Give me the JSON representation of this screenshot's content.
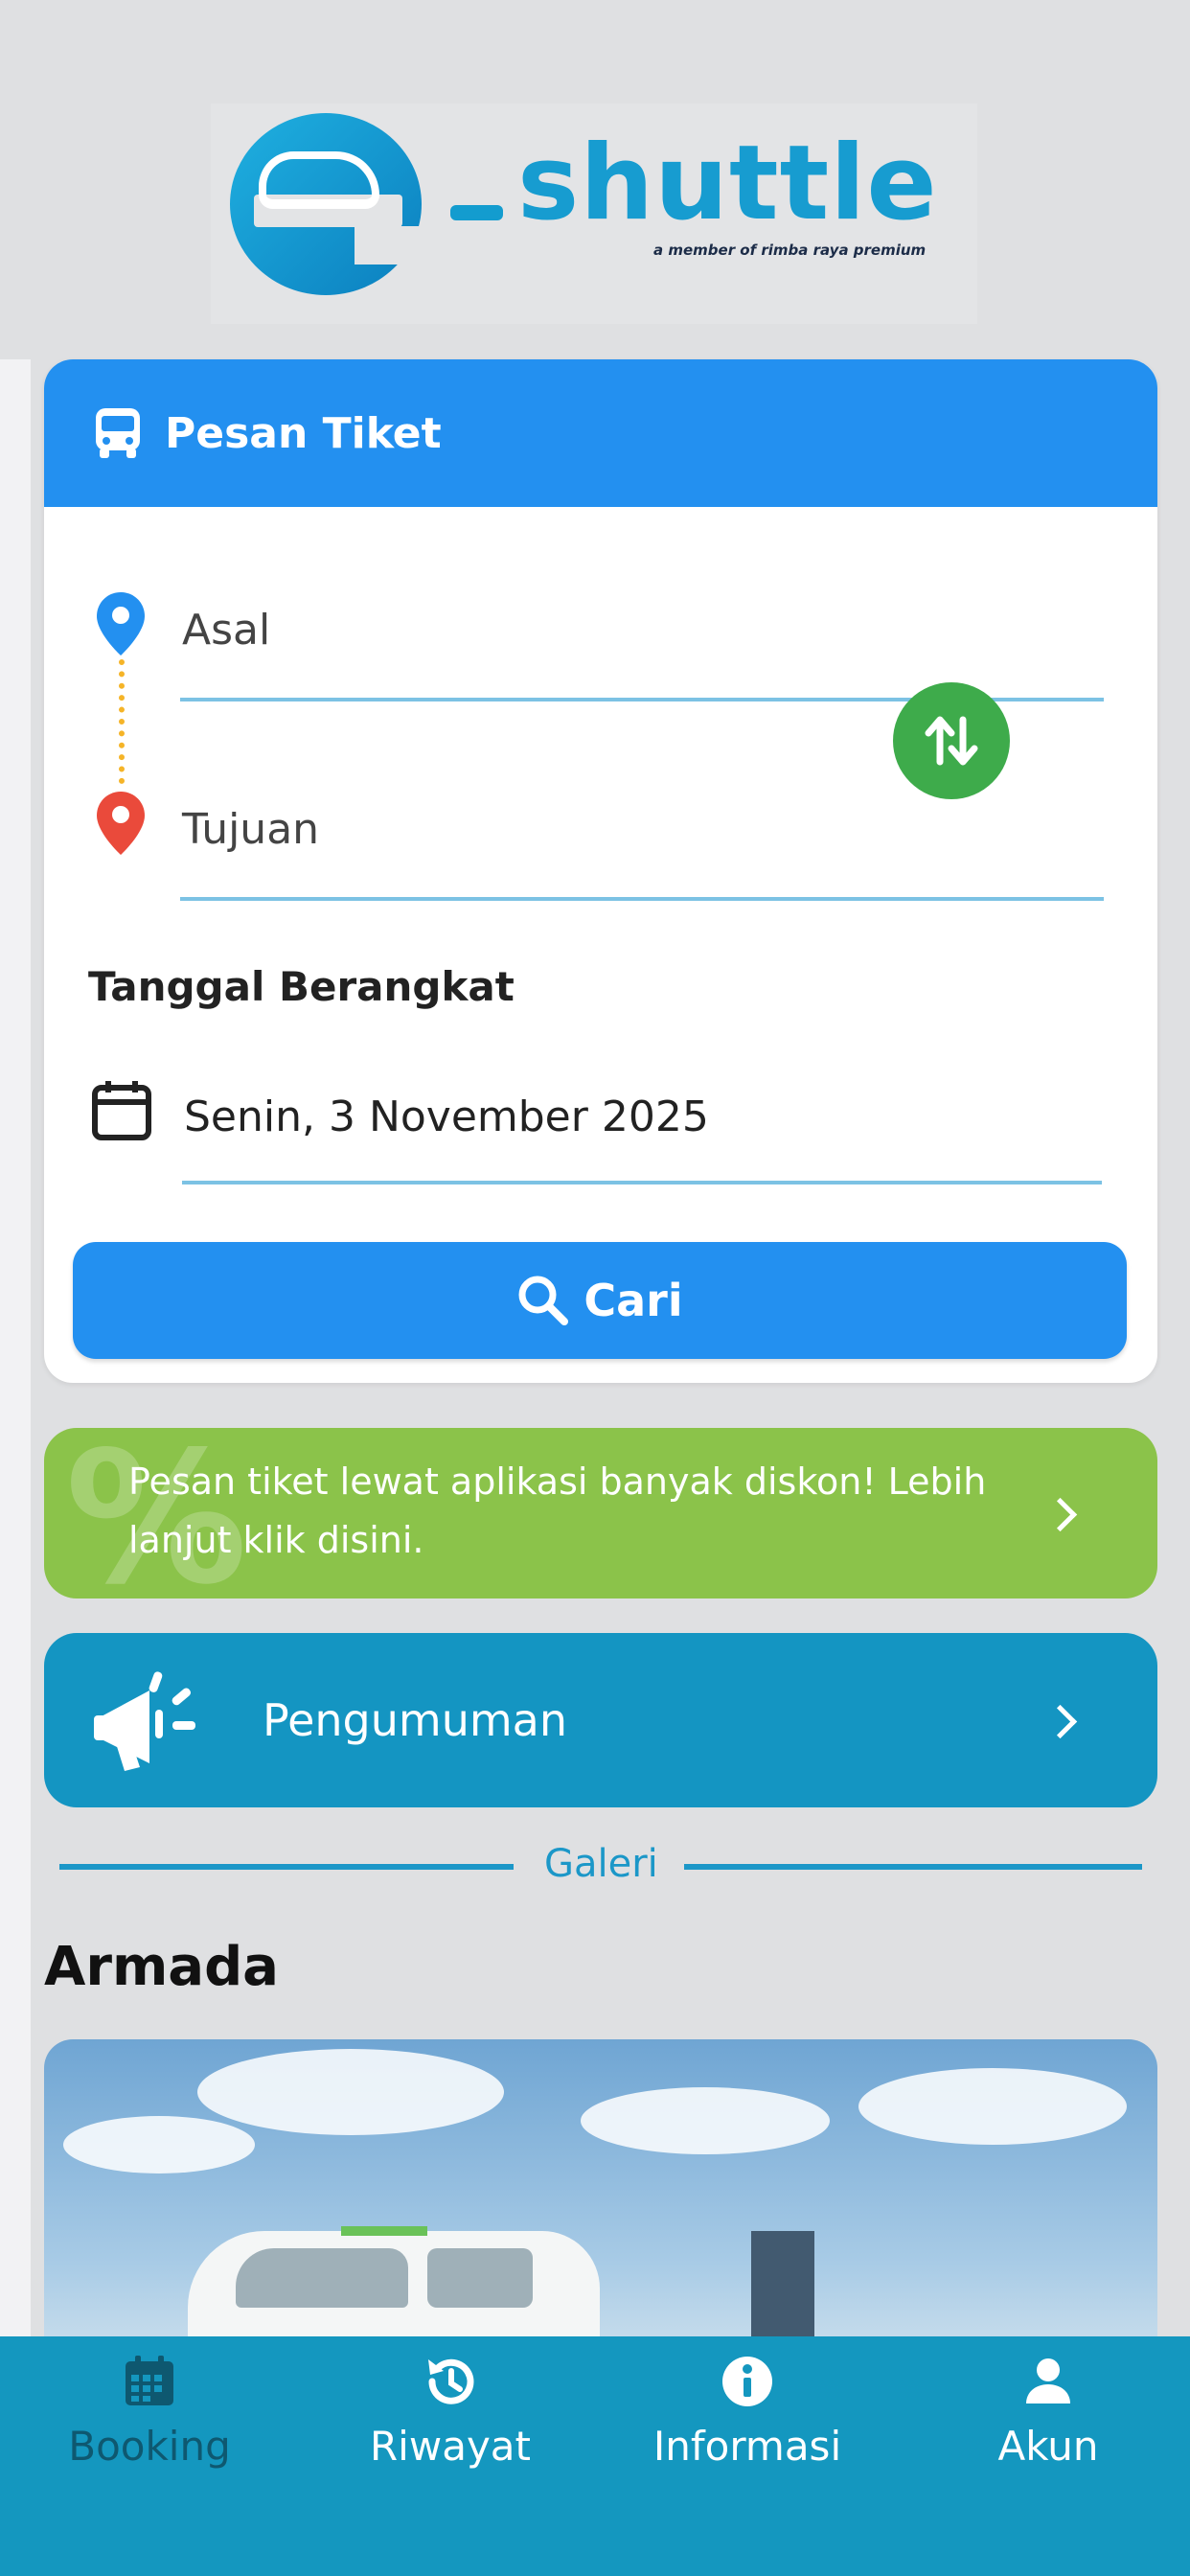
{
  "brand": {
    "name": "shuttle",
    "tagline": "a member of rimba raya premium"
  },
  "booking": {
    "header_title": "Pesan Tiket",
    "origin_placeholder": "Asal",
    "destination_placeholder": "Tujuan",
    "date_label": "Tanggal Berangkat",
    "date_value": "Senin, 3 November 2025",
    "search_label": "Cari"
  },
  "promo": {
    "text": "Pesan tiket lewat aplikasi banyak diskon! Lebih lanjut klik disini."
  },
  "announcement": {
    "label": "Pengumuman"
  },
  "gallery": {
    "divider_label": "Galeri",
    "section_title": "Armada"
  },
  "nav": {
    "items": [
      {
        "label": "Booking",
        "icon": "calendar-icon",
        "active": true
      },
      {
        "label": "Riwayat",
        "icon": "history-icon",
        "active": false
      },
      {
        "label": "Informasi",
        "icon": "info-icon",
        "active": false
      },
      {
        "label": "Akun",
        "icon": "person-icon",
        "active": false
      }
    ]
  },
  "colors": {
    "primary": "#2390f0",
    "swap_green": "#3eab4b",
    "promo_green": "#8bc34a",
    "announcement_blue": "#1495c2",
    "nav_bg": "#1497bf"
  }
}
